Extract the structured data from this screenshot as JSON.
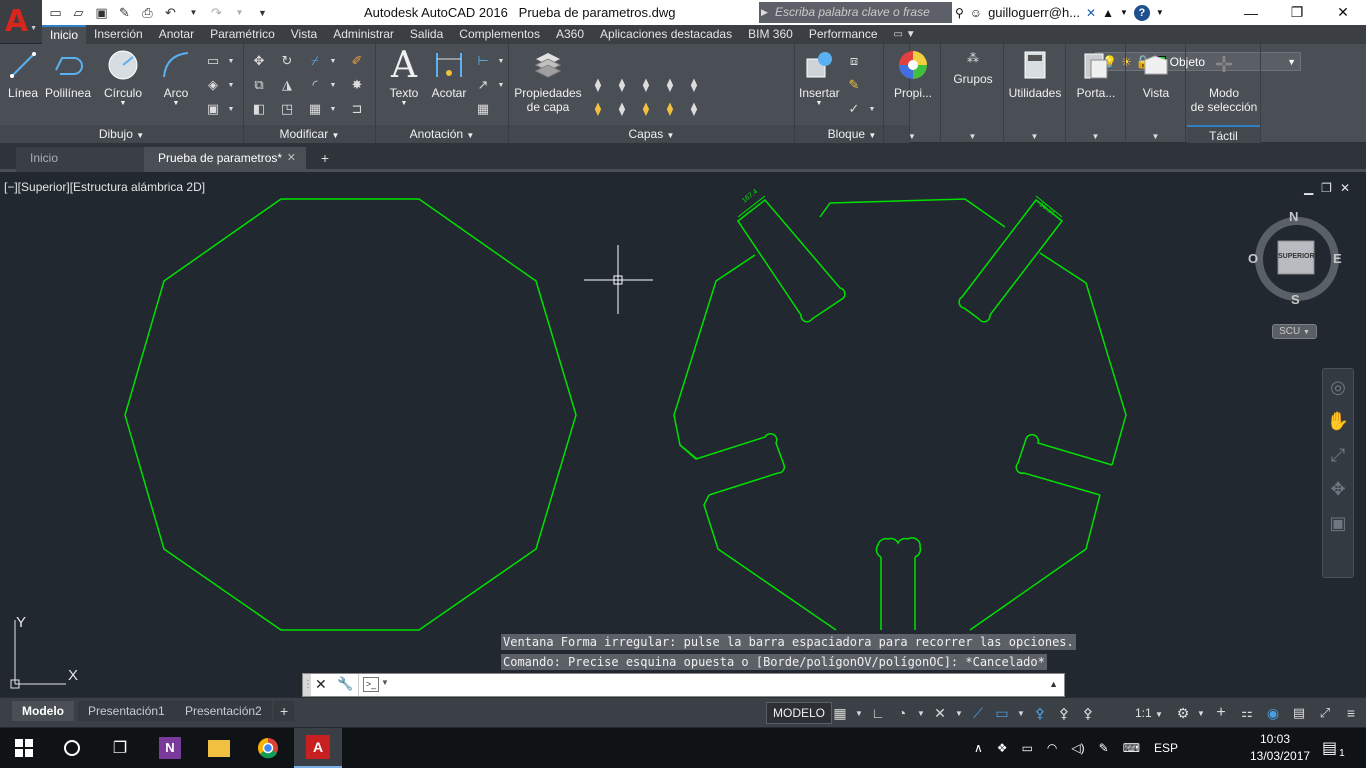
{
  "title_bar": {
    "app_name": "Autodesk AutoCAD 2016",
    "document_name": "Prueba de parametros.dwg",
    "search_placeholder": "Escriba palabra clave o frase",
    "user": "guilloguerr@h...",
    "help": "?"
  },
  "ribbon_tabs": [
    "Inicio",
    "Inserción",
    "Anotar",
    "Paramétrico",
    "Vista",
    "Administrar",
    "Salida",
    "Complementos",
    "A360",
    "Aplicaciones destacadas",
    "BIM 360",
    "Performance"
  ],
  "ribbon": {
    "dibujo": {
      "label": "Dibujo",
      "linea": "Línea",
      "polilinea": "Polilínea",
      "circulo": "Círculo",
      "arco": "Arco"
    },
    "modificar": {
      "label": "Modificar"
    },
    "anotacion": {
      "label": "Anotación",
      "texto": "Texto",
      "acotar": "Acotar"
    },
    "capas": {
      "label": "Capas",
      "propiedades_line1": "Propiedades",
      "propiedades_line2": "de capa",
      "current_layer": "Objeto"
    },
    "bloque": {
      "label": "Bloque",
      "insertar": "Insertar"
    },
    "propiedades": {
      "label": "Propi..."
    },
    "grupos": {
      "label": "Grupos"
    },
    "utilidades": {
      "label": "Utilidades"
    },
    "portapapeles": {
      "label": "Porta..."
    },
    "vista": {
      "label": "Vista"
    },
    "tactil": {
      "modo_line1": "Modo",
      "modo_line2": "de selección",
      "label": "Táctil"
    }
  },
  "file_tabs": {
    "inicio": "Inicio",
    "document": "Prueba de parametros*"
  },
  "viewport": {
    "label": "[−][Superior][Estructura alámbrica 2D]",
    "viewcube": {
      "n": "N",
      "s": "S",
      "e": "E",
      "o": "O",
      "face": "SUPERIOR"
    },
    "scu": "SCU",
    "ucs_x": "X",
    "ucs_y": "Y",
    "dim_left": "167.4",
    "dim_right": "16.34",
    "drawing_color": "#00e000"
  },
  "command": {
    "history": [
      "Ventana Forma irregular: pulse la barra espaciadora para recorrer las opciones.",
      "Comando: Precise esquina opuesta o [Borde/polígonOV/polígonOC]: *Cancelado*"
    ],
    "input_value": ""
  },
  "layout_tabs": [
    "Modelo",
    "Presentación1",
    "Presentación2"
  ],
  "status": {
    "modelo": "MODELO",
    "scale": "1:1"
  },
  "taskbar": {
    "lang": "ESP",
    "time": "10:03",
    "date": "13/03/2017",
    "notifications": "1"
  }
}
